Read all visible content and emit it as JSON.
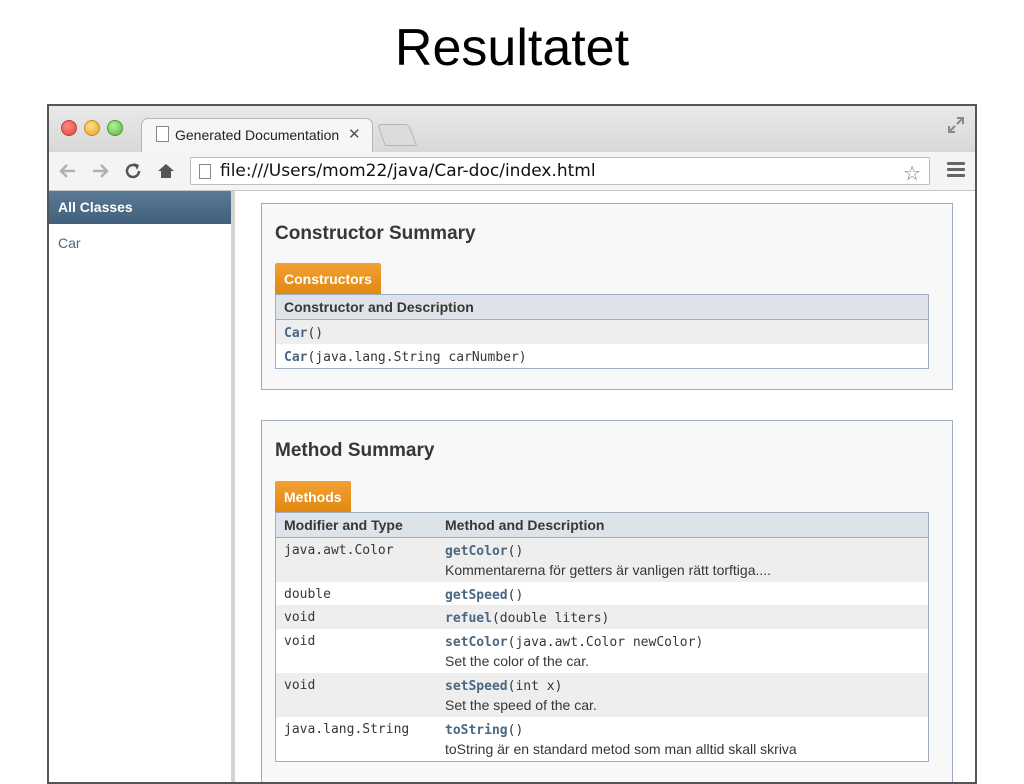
{
  "slide": {
    "title": "Resultatet"
  },
  "browser": {
    "tab_title": "Generated Documentation",
    "tab_close": "✕",
    "url": "file:///Users/mom22/java/Car-doc/index.html",
    "bookmark_glyph": "☆"
  },
  "sidebar": {
    "header": "All Classes",
    "classes": [
      "Car"
    ]
  },
  "constructor_summary": {
    "heading": "Constructor Summary",
    "caption": "Constructors",
    "column_header": "Constructor and Description",
    "rows": [
      {
        "name": "Car",
        "params": "()"
      },
      {
        "name": "Car",
        "params": "(java.lang.String carNumber)"
      }
    ]
  },
  "method_summary": {
    "heading": "Method Summary",
    "caption": "Methods",
    "column_headers": [
      "Modifier and Type",
      "Method and Description"
    ],
    "rows": [
      {
        "type": "java.awt.Color",
        "name": "getColor",
        "params": "()",
        "description": "Kommentarerna för getters är vanligen rätt torftiga...."
      },
      {
        "type": "double",
        "name": "getSpeed",
        "params": "()",
        "description": ""
      },
      {
        "type": "void",
        "name": "refuel",
        "params": "(double liters)",
        "description": ""
      },
      {
        "type": "void",
        "name": "setColor",
        "params": "(java.awt.Color newColor)",
        "description": "Set the color of the car."
      },
      {
        "type": "void",
        "name": "setSpeed",
        "params": "(int x)",
        "description": "Set the speed of the car."
      },
      {
        "type": "java.lang.String",
        "name": "toString",
        "params": "()",
        "description": "toString är en standard metod som man alltid skall skriva"
      }
    ]
  },
  "colors": {
    "link": "#4a6782",
    "caption_orange": "#e08810",
    "table_header": "#dee3e9",
    "sidebar_header": "#4c6c87"
  }
}
